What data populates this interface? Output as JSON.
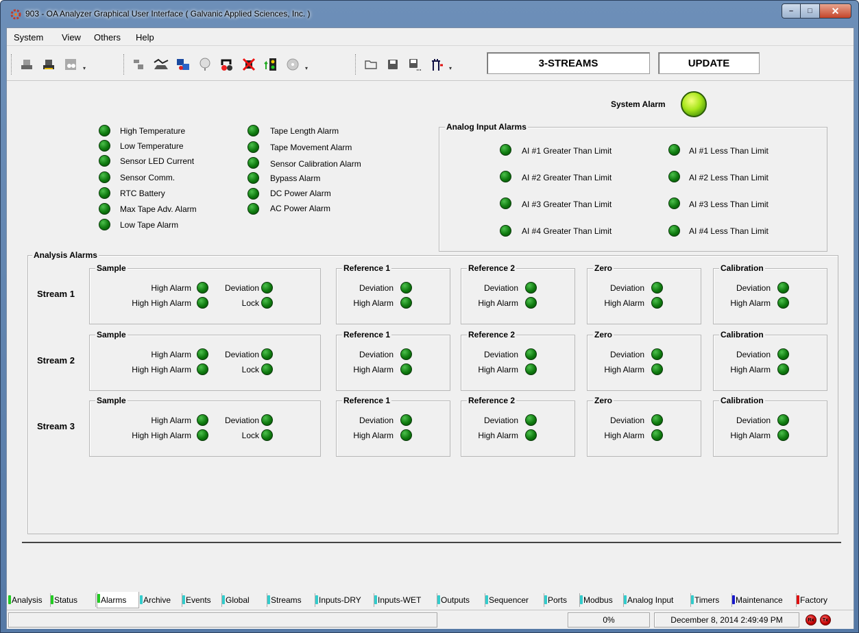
{
  "window": {
    "title": "903 - OA Analyzer Graphical User Interface  ( Galvanic Applied Sciences, Inc. )",
    "min": "–",
    "max": "□",
    "close": "✕"
  },
  "menu": [
    "System",
    "View",
    "Others",
    "Help"
  ],
  "toolbar": {
    "icons": [
      "connect-icon",
      "disconnect-icon",
      "device-icon",
      "config-icon",
      "chart-icon",
      "transfer-icon",
      "gauge-icon",
      "reset-icon",
      "stop-icon",
      "signal-icon",
      "cd-icon",
      "open-icon",
      "save-icon",
      "save-as-icon",
      "exit-icon"
    ],
    "streams_label": "3-STREAMS",
    "update_label": "UPDATE"
  },
  "system_alarm": {
    "label": "System Alarm",
    "color": "#a7e61b"
  },
  "general_alarms_col1": [
    "High Temperature",
    "Low Temperature",
    "Sensor LED Current",
    "Sensor Comm.",
    "RTC Battery",
    "Max Tape Adv. Alarm",
    "Low Tape Alarm"
  ],
  "general_alarms_col2": [
    "Tape Length Alarm",
    "Tape Movement Alarm",
    "Sensor Calibration Alarm",
    "Bypass Alarm",
    "DC Power Alarm",
    "AC Power Alarm"
  ],
  "analog_input": {
    "title": "Analog Input Alarms",
    "greater": [
      "AI #1 Greater Than Limit",
      "AI #2 Greater Than Limit",
      "AI #3 Greater Than Limit",
      "AI #4 Greater Than Limit"
    ],
    "less": [
      "AI #1 Less Than Limit",
      "AI #2 Less Than Limit",
      "AI #3 Less Than Limit",
      "AI #4 Less Than Limit"
    ]
  },
  "analysis": {
    "title": "Analysis Alarms",
    "streams": [
      "Stream 1",
      "Stream 2",
      "Stream 3"
    ],
    "sample": {
      "title": "Sample",
      "high": "High Alarm",
      "high_high": "High High Alarm",
      "deviation": "Deviation",
      "lock": "Lock"
    },
    "ref1": {
      "title": "Reference 1",
      "deviation": "Deviation",
      "high": "High Alarm"
    },
    "ref2": {
      "title": "Reference 2",
      "deviation": "Deviation",
      "high": "High Alarm"
    },
    "zero": {
      "title": "Zero",
      "deviation": "Deviation",
      "high": "High Alarm"
    },
    "cal": {
      "title": "Calibration",
      "deviation": "Deviation",
      "high": "High Alarm"
    }
  },
  "tabs": [
    {
      "label": "Analysis",
      "color": "#22cc22"
    },
    {
      "label": "Status",
      "color": "#22cc22"
    },
    {
      "label": "Alarms",
      "color": "#22cc22"
    },
    {
      "label": "Archive",
      "color": "#33cccc"
    },
    {
      "label": "Events",
      "color": "#33cccc"
    },
    {
      "label": "Global",
      "color": "#33cccc"
    },
    {
      "label": "Streams",
      "color": "#33cccc"
    },
    {
      "label": "Inputs-DRY",
      "color": "#33cccc"
    },
    {
      "label": "Inputs-WET",
      "color": "#33cccc"
    },
    {
      "label": "Outputs",
      "color": "#33cccc"
    },
    {
      "label": "Sequencer",
      "color": "#33cccc"
    },
    {
      "label": "Ports",
      "color": "#33cccc"
    },
    {
      "label": "Modbus",
      "color": "#33cccc"
    },
    {
      "label": "Analog Input",
      "color": "#33cccc"
    },
    {
      "label": "Timers",
      "color": "#33cccc"
    },
    {
      "label": "Maintenance",
      "color": "#1a1acc"
    },
    {
      "label": "Factory",
      "color": "#dd1111"
    }
  ],
  "status": {
    "progress": "0%",
    "datetime": "December 8, 2014 2:49:49 PM",
    "rx": "Rx",
    "tx": "Tx"
  }
}
